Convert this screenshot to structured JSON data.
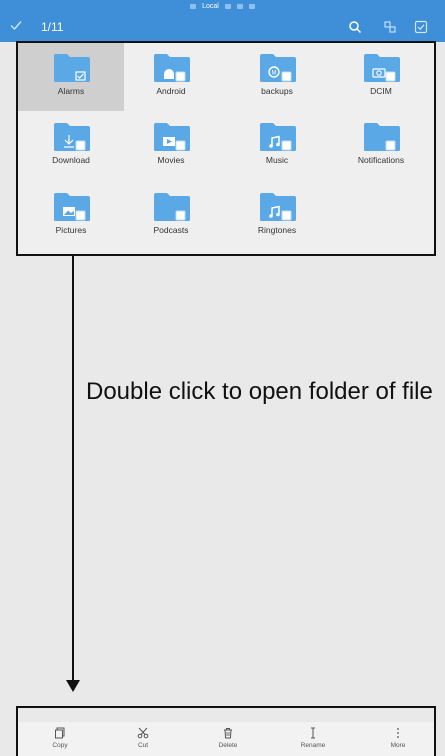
{
  "status": {
    "location_label": "Local"
  },
  "header": {
    "selection_count": "1/11"
  },
  "folders": [
    {
      "name": "Alarms",
      "emblem": "check-icon",
      "selected": true
    },
    {
      "name": "Android",
      "emblem": "android-icon",
      "selected": false
    },
    {
      "name": "backups",
      "emblem": "backup-icon",
      "selected": false
    },
    {
      "name": "DCIM",
      "emblem": "camera-icon",
      "selected": false
    },
    {
      "name": "Download",
      "emblem": "download-icon",
      "selected": false
    },
    {
      "name": "Movies",
      "emblem": "play-icon",
      "selected": false
    },
    {
      "name": "Music",
      "emblem": "music-icon",
      "selected": false
    },
    {
      "name": "Notifications",
      "emblem": "none",
      "selected": false
    },
    {
      "name": "Pictures",
      "emblem": "image-icon",
      "selected": false
    },
    {
      "name": "Podcasts",
      "emblem": "none",
      "selected": false
    },
    {
      "name": "Ringtones",
      "emblem": "music-icon",
      "selected": false
    }
  ],
  "annotation": {
    "text": "Double click to open folder of file"
  },
  "toolbar": {
    "copy": "Copy",
    "cut": "Cut",
    "delete": "Delete",
    "rename": "Rename",
    "more": "More"
  },
  "colors": {
    "accent": "#3e8fd8",
    "folder": "#5aa8e6",
    "background": "#efeff0"
  }
}
